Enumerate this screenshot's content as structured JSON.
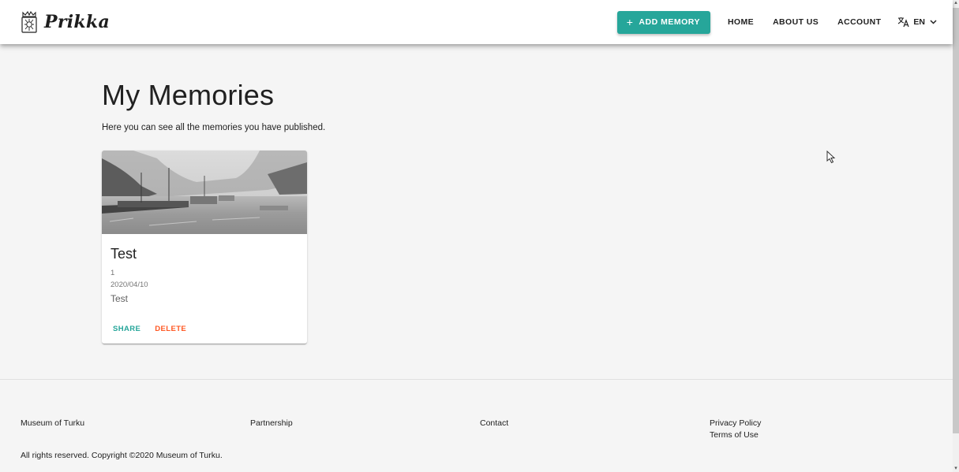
{
  "header": {
    "brand": "Prikka",
    "add_memory": "ADD MEMORY",
    "add_icon": "plus-icon",
    "nav": [
      "HOME",
      "ABOUT US",
      "ACCOUNT"
    ],
    "language": "EN",
    "language_icon": "translate-icon",
    "accent_color": "#26a69a"
  },
  "main": {
    "title": "My Memories",
    "subtitle": "Here you can see all the memories you have published."
  },
  "memories": [
    {
      "title": "Test",
      "number": "1",
      "date": "2020/04/10",
      "description": "Test",
      "share_label": "SHARE",
      "delete_label": "DELETE"
    }
  ],
  "footer": {
    "museum": "Museum of Turku",
    "partnership": "Partnership",
    "contact": "Contact",
    "privacy": "Privacy Policy",
    "terms": "Terms of Use",
    "copyright": "All rights reserved. Copyright ©2020 Museum of Turku."
  }
}
